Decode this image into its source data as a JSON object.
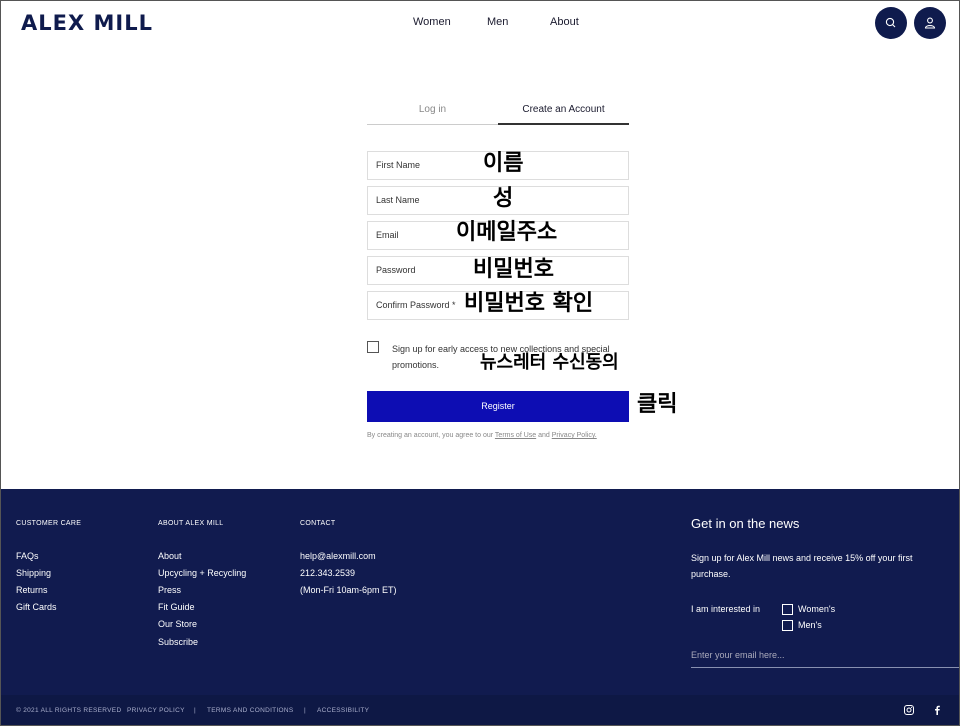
{
  "header": {
    "logo": "ALEX MILL",
    "nav": [
      "Women",
      "Men",
      "About"
    ],
    "search_icon": "search-icon",
    "account_icon": "user-icon"
  },
  "tabs": {
    "login": "Log in",
    "create": "Create an Account"
  },
  "form": {
    "first_name": "First Name",
    "last_name": "Last Name",
    "email": "Email",
    "password": "Password",
    "confirm_password": "Confirm Password *",
    "newsletter": "Sign up for early access to new collections and special promotions.",
    "register": "Register",
    "terms_prefix": "By creating an account, you agree to our",
    "terms_link": "Terms of Use",
    "terms_and": "and",
    "privacy_link": "Privacy Policy."
  },
  "annotations": {
    "first_name": "이름",
    "last_name": "성",
    "email": "이메일주소",
    "password": "비밀번호",
    "confirm_password": "비밀번호 확인",
    "newsletter": "뉴스레터 수신동의",
    "register": "클릭"
  },
  "footer": {
    "customer_care": {
      "title": "CUSTOMER CARE",
      "links": [
        "FAQs",
        "Shipping",
        "Returns",
        "Gift Cards"
      ]
    },
    "about": {
      "title": "ABOUT ALEX MILL",
      "links": [
        "About",
        "Upcycling + Recycling",
        "Press",
        "Fit Guide",
        "Our Store",
        "Subscribe"
      ]
    },
    "contact": {
      "title": "CONTACT",
      "links": [
        "help@alexmill.com",
        "212.343.2539",
        "(Mon-Fri 10am-6pm ET)"
      ]
    },
    "news": {
      "title": "Get in on the news",
      "text": "Sign up for Alex Mill news and receive 15% off your first purchase.",
      "interest_label": "I am interested in",
      "options": [
        "Women's",
        "Men's"
      ],
      "email_placeholder": "Enter your email here..."
    }
  },
  "bottom": {
    "copyright": "© 2021 ALL RIGHTS RESERVED",
    "privacy": "PRIVACY POLICY",
    "sep": "|",
    "terms": "TERMS AND CONDITIONS",
    "accessibility": "ACCESSIBILITY",
    "instagram_icon": "instagram-icon",
    "facebook_icon": "facebook-icon"
  },
  "colors": {
    "navy": "#111b4f",
    "register_blue": "#0d0db3"
  }
}
